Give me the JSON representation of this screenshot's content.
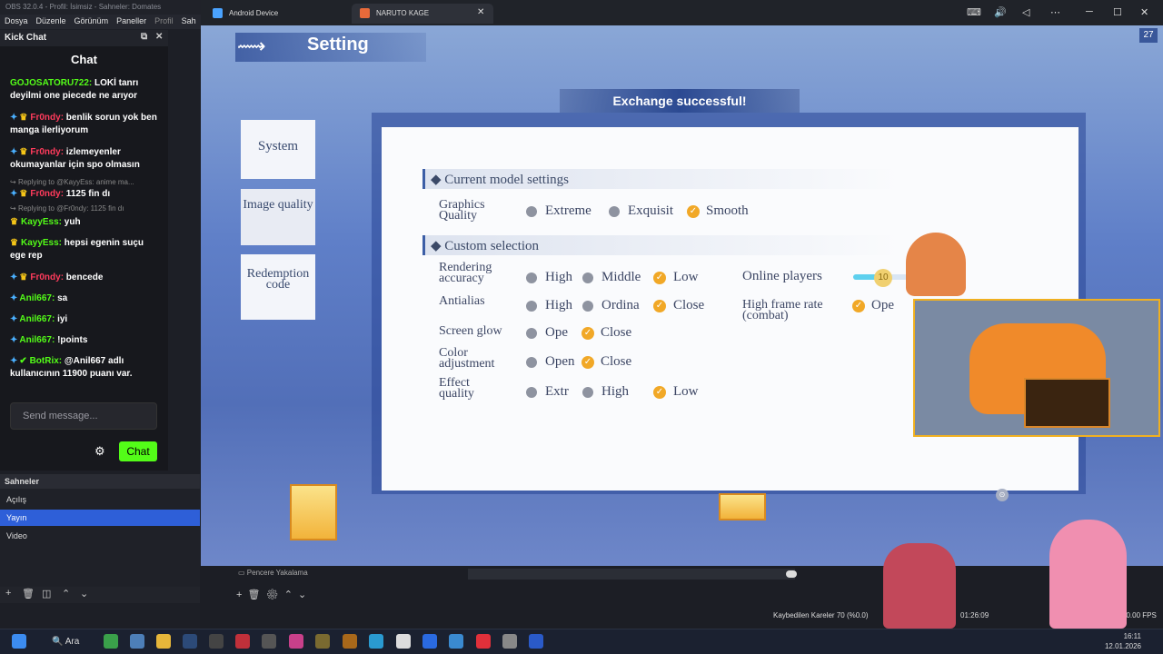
{
  "obs": {
    "title": "OBS 32.0.4 - Profil: İsimsiz - Sahneler: Domates",
    "menu": [
      "Dosya",
      "Düzenle",
      "Görünüm",
      "Paneller",
      "Profil",
      "Sah"
    ],
    "chat_dock_title": "Kick Chat",
    "chat_title": "Chat",
    "send_placeholder": "Send message...",
    "chat_button": "Chat",
    "scenes_header": "Sahneler",
    "scenes": [
      "Açılış",
      "Yayın",
      "Video"
    ],
    "window_capture": "Pencere Yakalama",
    "lost_frames": "Kaybedilen Kareler 70 (%0.0)",
    "record_time": "01:26:09",
    "fps": "60.00 FPS"
  },
  "chat": {
    "messages": [
      {
        "user": "GOJOSATORU722:",
        "text": " LOKİ tanrı deyilmi one piecede ne arıyor",
        "style": "green"
      },
      {
        "user": "Fr0ndy:",
        "text": " benlik sorun yok ben manga ilerliyorum",
        "style": "red"
      },
      {
        "user": "Fr0ndy:",
        "text": " izlemeyenler okumayanlar için spo olmasın",
        "style": "red"
      },
      {
        "reply": "Replying to @KayyEss: anime ma..."
      },
      {
        "user": "Fr0ndy:",
        "text": " 1125 fin dı",
        "style": "red"
      },
      {
        "reply": "Replying to @Fr0ndy: 1125 fin dı"
      },
      {
        "user": "KayyEss:",
        "text": " yuh",
        "style": "green"
      },
      {
        "user": "KayyEss:",
        "text": " hepsi egenin suçu ege rep",
        "style": "green"
      },
      {
        "user": "Fr0ndy:",
        "text": " bencede",
        "style": "red"
      },
      {
        "user": "Anil667:",
        "text": " sa",
        "style": "green"
      },
      {
        "user": "Anil667:",
        "text": " iyi",
        "style": "green"
      },
      {
        "user": "Anil667:",
        "text": " !points",
        "style": "green"
      },
      {
        "user": "BotRix:",
        "text": " @Anil667 adlı kullanıcının 11900 puanı var.",
        "style": "green"
      }
    ]
  },
  "window": {
    "tab1": "Android Device",
    "tab2": "NARUTO KAGE"
  },
  "game": {
    "setting_title": "Setting",
    "badge": "27",
    "exchange_msg": "Exchange successful!",
    "tabs": {
      "system": "System",
      "image": "Image quality",
      "redeem": "Redemption code"
    },
    "current_model": "Current model settings",
    "custom_selection": "Custom selection",
    "graphics_quality": {
      "label": "Graphics Quality",
      "options": [
        "Extreme",
        "Exquisit",
        "Smooth"
      ],
      "selected": "Smooth"
    },
    "rendering_accuracy": {
      "label": "Rendering accuracy",
      "options": [
        "High",
        "Middle",
        "Low"
      ],
      "selected": "Low"
    },
    "antialias": {
      "label": "Antialias",
      "options": [
        "High",
        "Ordina",
        "Close"
      ],
      "selected": "Close"
    },
    "screen_glow": {
      "label": "Screen glow",
      "options": [
        "Ope",
        "Close"
      ],
      "selected": "Close"
    },
    "color_adjustment": {
      "label": "Color adjustment",
      "options": [
        "Open",
        "Close"
      ],
      "selected": "Close"
    },
    "effect_quality": {
      "label": "Effect quality",
      "options": [
        "Extr",
        "High",
        "Low"
      ],
      "selected": "Low"
    },
    "online_players": {
      "label": "Online players",
      "value": "10",
      "level": 0.55
    },
    "high_frame_rate": {
      "label": "High frame rate (combat)",
      "option": "Ope"
    }
  },
  "taskbar": {
    "search": "Ara",
    "time": "16:11",
    "date": "12.01.2026"
  }
}
